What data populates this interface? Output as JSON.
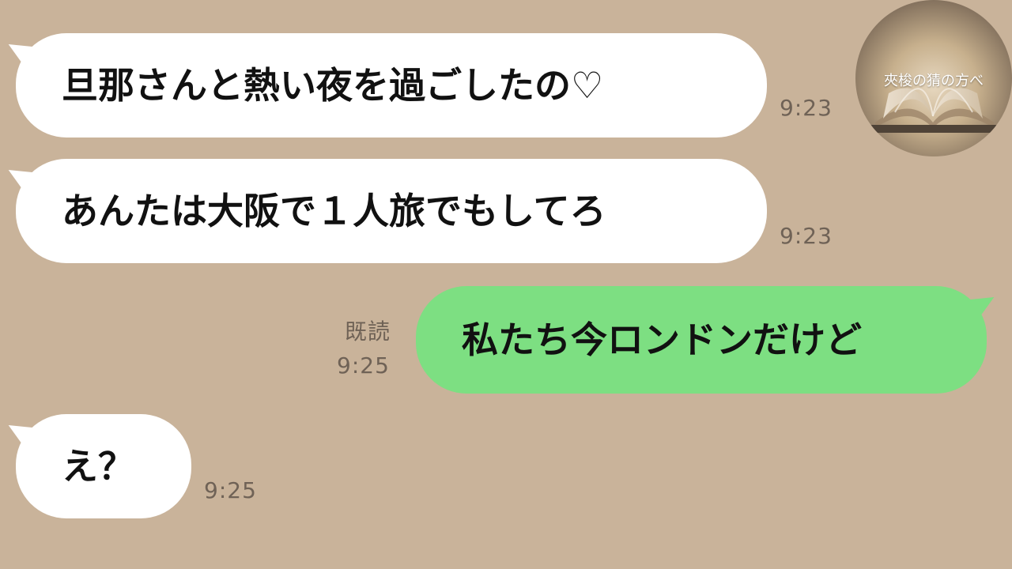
{
  "chat": {
    "messages": [
      {
        "direction": "incoming",
        "text": "旦那さんと熱い夜を過ごしたの♡",
        "time": "9:23"
      },
      {
        "direction": "incoming",
        "text": "あんたは大阪で１人旅でもしてろ",
        "time": "9:23"
      },
      {
        "direction": "outgoing",
        "text": "私たち今ロンドンだけど",
        "read": "既読",
        "time": "9:25"
      },
      {
        "direction": "incoming",
        "text": "え？",
        "time": "9:25"
      }
    ]
  },
  "avatar": {
    "label": "夾梭の猜の方べ"
  },
  "colors": {
    "background": "#c9b39a",
    "incoming_bubble": "#ffffff",
    "outgoing_bubble": "#7ddf82",
    "timestamp": "#6f6256"
  }
}
